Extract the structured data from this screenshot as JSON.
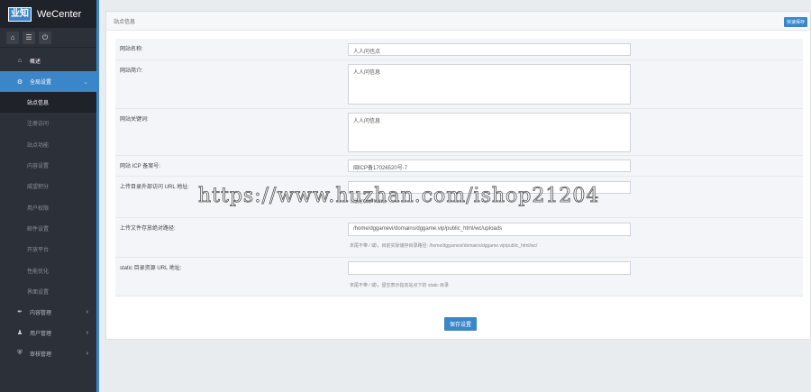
{
  "brand": {
    "logo_cn": "业知",
    "name": "WeCenter"
  },
  "sidebar": {
    "home": {
      "icon": "home-icon",
      "label": "概述"
    },
    "global_settings": {
      "icon": "gear-icon",
      "label": "全局设置"
    },
    "sub_items": [
      {
        "label": "站点信息"
      },
      {
        "label": "注册访问"
      },
      {
        "label": "站点功能"
      },
      {
        "label": "内容设置"
      },
      {
        "label": "威望积分"
      },
      {
        "label": "用户权限"
      },
      {
        "label": "邮件设置"
      },
      {
        "label": "开放平台"
      },
      {
        "label": "性能优化"
      },
      {
        "label": "界面设置"
      }
    ],
    "groups": [
      {
        "icon": "pen-icon",
        "label": "内容管理"
      },
      {
        "icon": "user-icon",
        "label": "用户管理"
      },
      {
        "icon": "shield-icon",
        "label": "审核管理"
      }
    ]
  },
  "page": {
    "title": "站点信息",
    "quick_button": "快速保存"
  },
  "form": {
    "site_name": {
      "label": "网站名称:",
      "value": "人人问也点"
    },
    "site_intro": {
      "label": "网站简介:",
      "value": "人人问信息"
    },
    "site_keywords": {
      "label": "网站关键词:",
      "value": "人人问信息"
    },
    "icp": {
      "label": "网站 ICP 备案号:",
      "value": "闽ICP备17026520号-7"
    },
    "upload_url": {
      "label": "上传目录外部访问 URL 地址:",
      "value": "",
      "hint": "请留空表示不启用"
    },
    "upload_dir": {
      "label": "上传文件存放绝对路径:",
      "value": "/home/dggamevi/domains/dggame.vip/public_html/wc/uploads",
      "hint": "末尾不带 / 或\\，目前实际储存目录路径: /home/dggamevi/domains/dggame.vip/public_html/wc/"
    },
    "static_url": {
      "label": "static 目录资源 URL 地址:",
      "value": "",
      "hint": "末尾不带 / 或\\，留空表示指向站点下的 static 目录"
    },
    "save_button": "保存设置"
  },
  "watermark": "https://www.huzhan.com/ishop21204"
}
